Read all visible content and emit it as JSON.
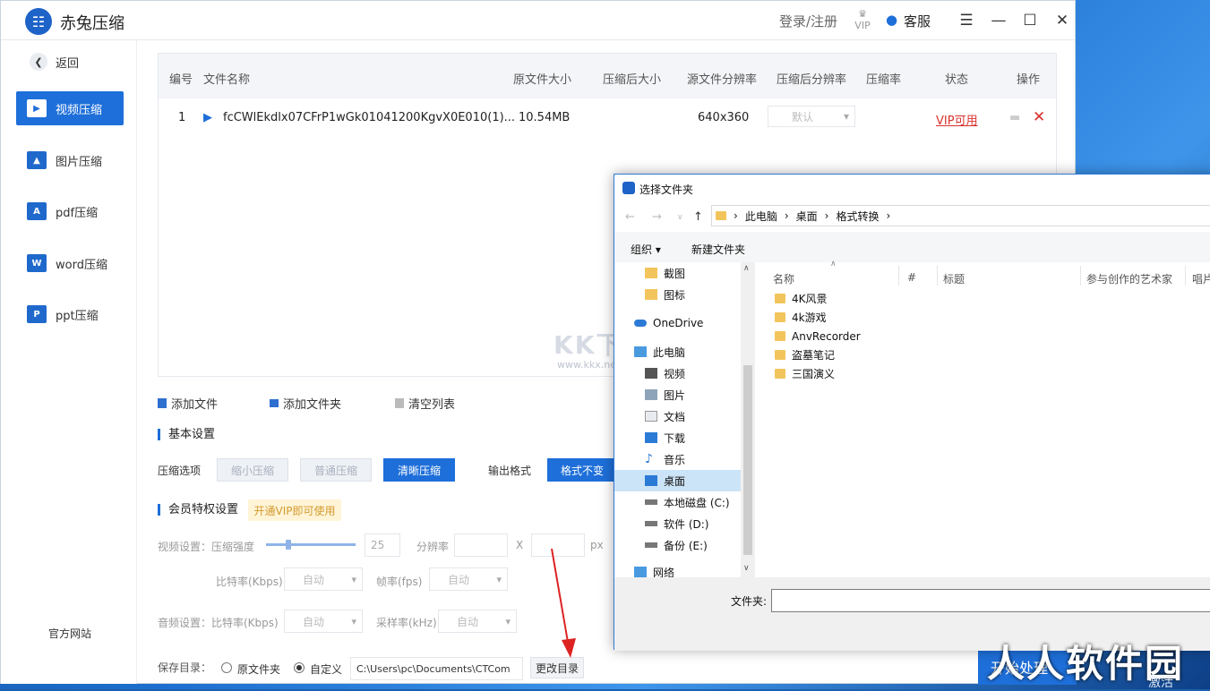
{
  "app": {
    "title": "赤兔压缩",
    "logo_glyph": "☷",
    "login": "登录/注册",
    "vip": "VIP",
    "service": "客服"
  },
  "sidebar": {
    "back": "返回",
    "items": [
      {
        "label": "视频压缩",
        "icon": "video-icon",
        "glyph": "▶"
      },
      {
        "label": "图片压缩",
        "icon": "image-icon",
        "glyph": "▲"
      },
      {
        "label": "pdf压缩",
        "icon": "pdf-icon",
        "glyph": "A"
      },
      {
        "label": "word压缩",
        "icon": "word-icon",
        "glyph": "W"
      },
      {
        "label": "ppt压缩",
        "icon": "ppt-icon",
        "glyph": "P"
      }
    ],
    "footer": "官方网站"
  },
  "table": {
    "headers": [
      "编号",
      "文件名称",
      "原文件大小",
      "压缩后大小",
      "源文件分辨率",
      "压缩后分辨率",
      "压缩率",
      "状态",
      "操作"
    ],
    "rows": [
      {
        "index": "1",
        "name": "fcCWlEkdlx07CFrP1wGk01041200KgvX0E010(1)...",
        "size": "10.54MB",
        "resolution": "640x360",
        "target_resolution": "默认",
        "status": "VIP可用"
      }
    ]
  },
  "toolbar": {
    "add_file": "添加文件",
    "add_folder": "添加文件夹",
    "clear": "清空列表"
  },
  "basic": {
    "title": "基本设置",
    "compress_label": "压缩选项",
    "options": [
      "缩小压缩",
      "普通压缩",
      "清晰压缩"
    ],
    "output_label": "输出格式",
    "output_value": "格式不变"
  },
  "vip": {
    "title": "会员特权设置",
    "badge": "开通VIP即可使用",
    "video_label": "视频设置：压缩强度",
    "strength": "25",
    "resolution_label": "分辨率",
    "x": "X",
    "px": "px",
    "bitrate_label": "比特率(Kbps)",
    "bitrate": "自动",
    "fps_label": "帧率(fps)",
    "fps": "自动",
    "audio_label": "音频设置：比特率(Kbps)",
    "audio_bitrate": "自动",
    "samplerate_label": "采样率(kHz)",
    "samplerate": "自动",
    "strength_level": 0.25
  },
  "save": {
    "label": "保存目录：",
    "original": "原文件夹",
    "custom": "自定义",
    "path": "C:\\Users\\pc\\Documents\\CTCom",
    "change": "更改目录"
  },
  "start": "开始处理",
  "watermarks": {
    "kkx": "KK下载",
    "kkx_url": "www.kkx.net",
    "rrr": "人人软件园",
    "activate": "激活"
  },
  "dialog": {
    "title": "选择文件夹",
    "path": [
      "此电脑",
      "桌面",
      "格式转换"
    ],
    "organize": "组织 ▾",
    "new_folder": "新建文件夹",
    "tree": [
      {
        "label": "截图",
        "icon": "folder-icon"
      },
      {
        "label": "图标",
        "icon": "folder-icon"
      },
      {
        "label": "OneDrive",
        "icon": "cloud-icon"
      },
      {
        "label": "此电脑",
        "icon": "computer-icon"
      },
      {
        "label": "视频",
        "icon": "video-folder-icon"
      },
      {
        "label": "图片",
        "icon": "picture-folder-icon"
      },
      {
        "label": "文档",
        "icon": "document-folder-icon"
      },
      {
        "label": "下载",
        "icon": "download-icon"
      },
      {
        "label": "音乐",
        "icon": "music-icon"
      },
      {
        "label": "桌面",
        "icon": "desktop-icon"
      },
      {
        "label": "本地磁盘 (C:)",
        "icon": "drive-icon"
      },
      {
        "label": "软件 (D:)",
        "icon": "drive-icon"
      },
      {
        "label": "备份 (E:)",
        "icon": "drive-icon"
      },
      {
        "label": "网络",
        "icon": "network-icon"
      }
    ],
    "columns": [
      "名称",
      "#",
      "标题",
      "参与创作的艺术家",
      "唱片"
    ],
    "files": [
      "4K风景",
      "4k游戏",
      "AnvRecorder",
      "盗墓笔记",
      "三国演义"
    ],
    "folder_label": "文件夹:"
  },
  "colors": {
    "accent": "#1e6fd9",
    "vip_red": "#d9302c",
    "badge_bg": "#fff4d6",
    "badge_fg": "#d39a2e"
  }
}
